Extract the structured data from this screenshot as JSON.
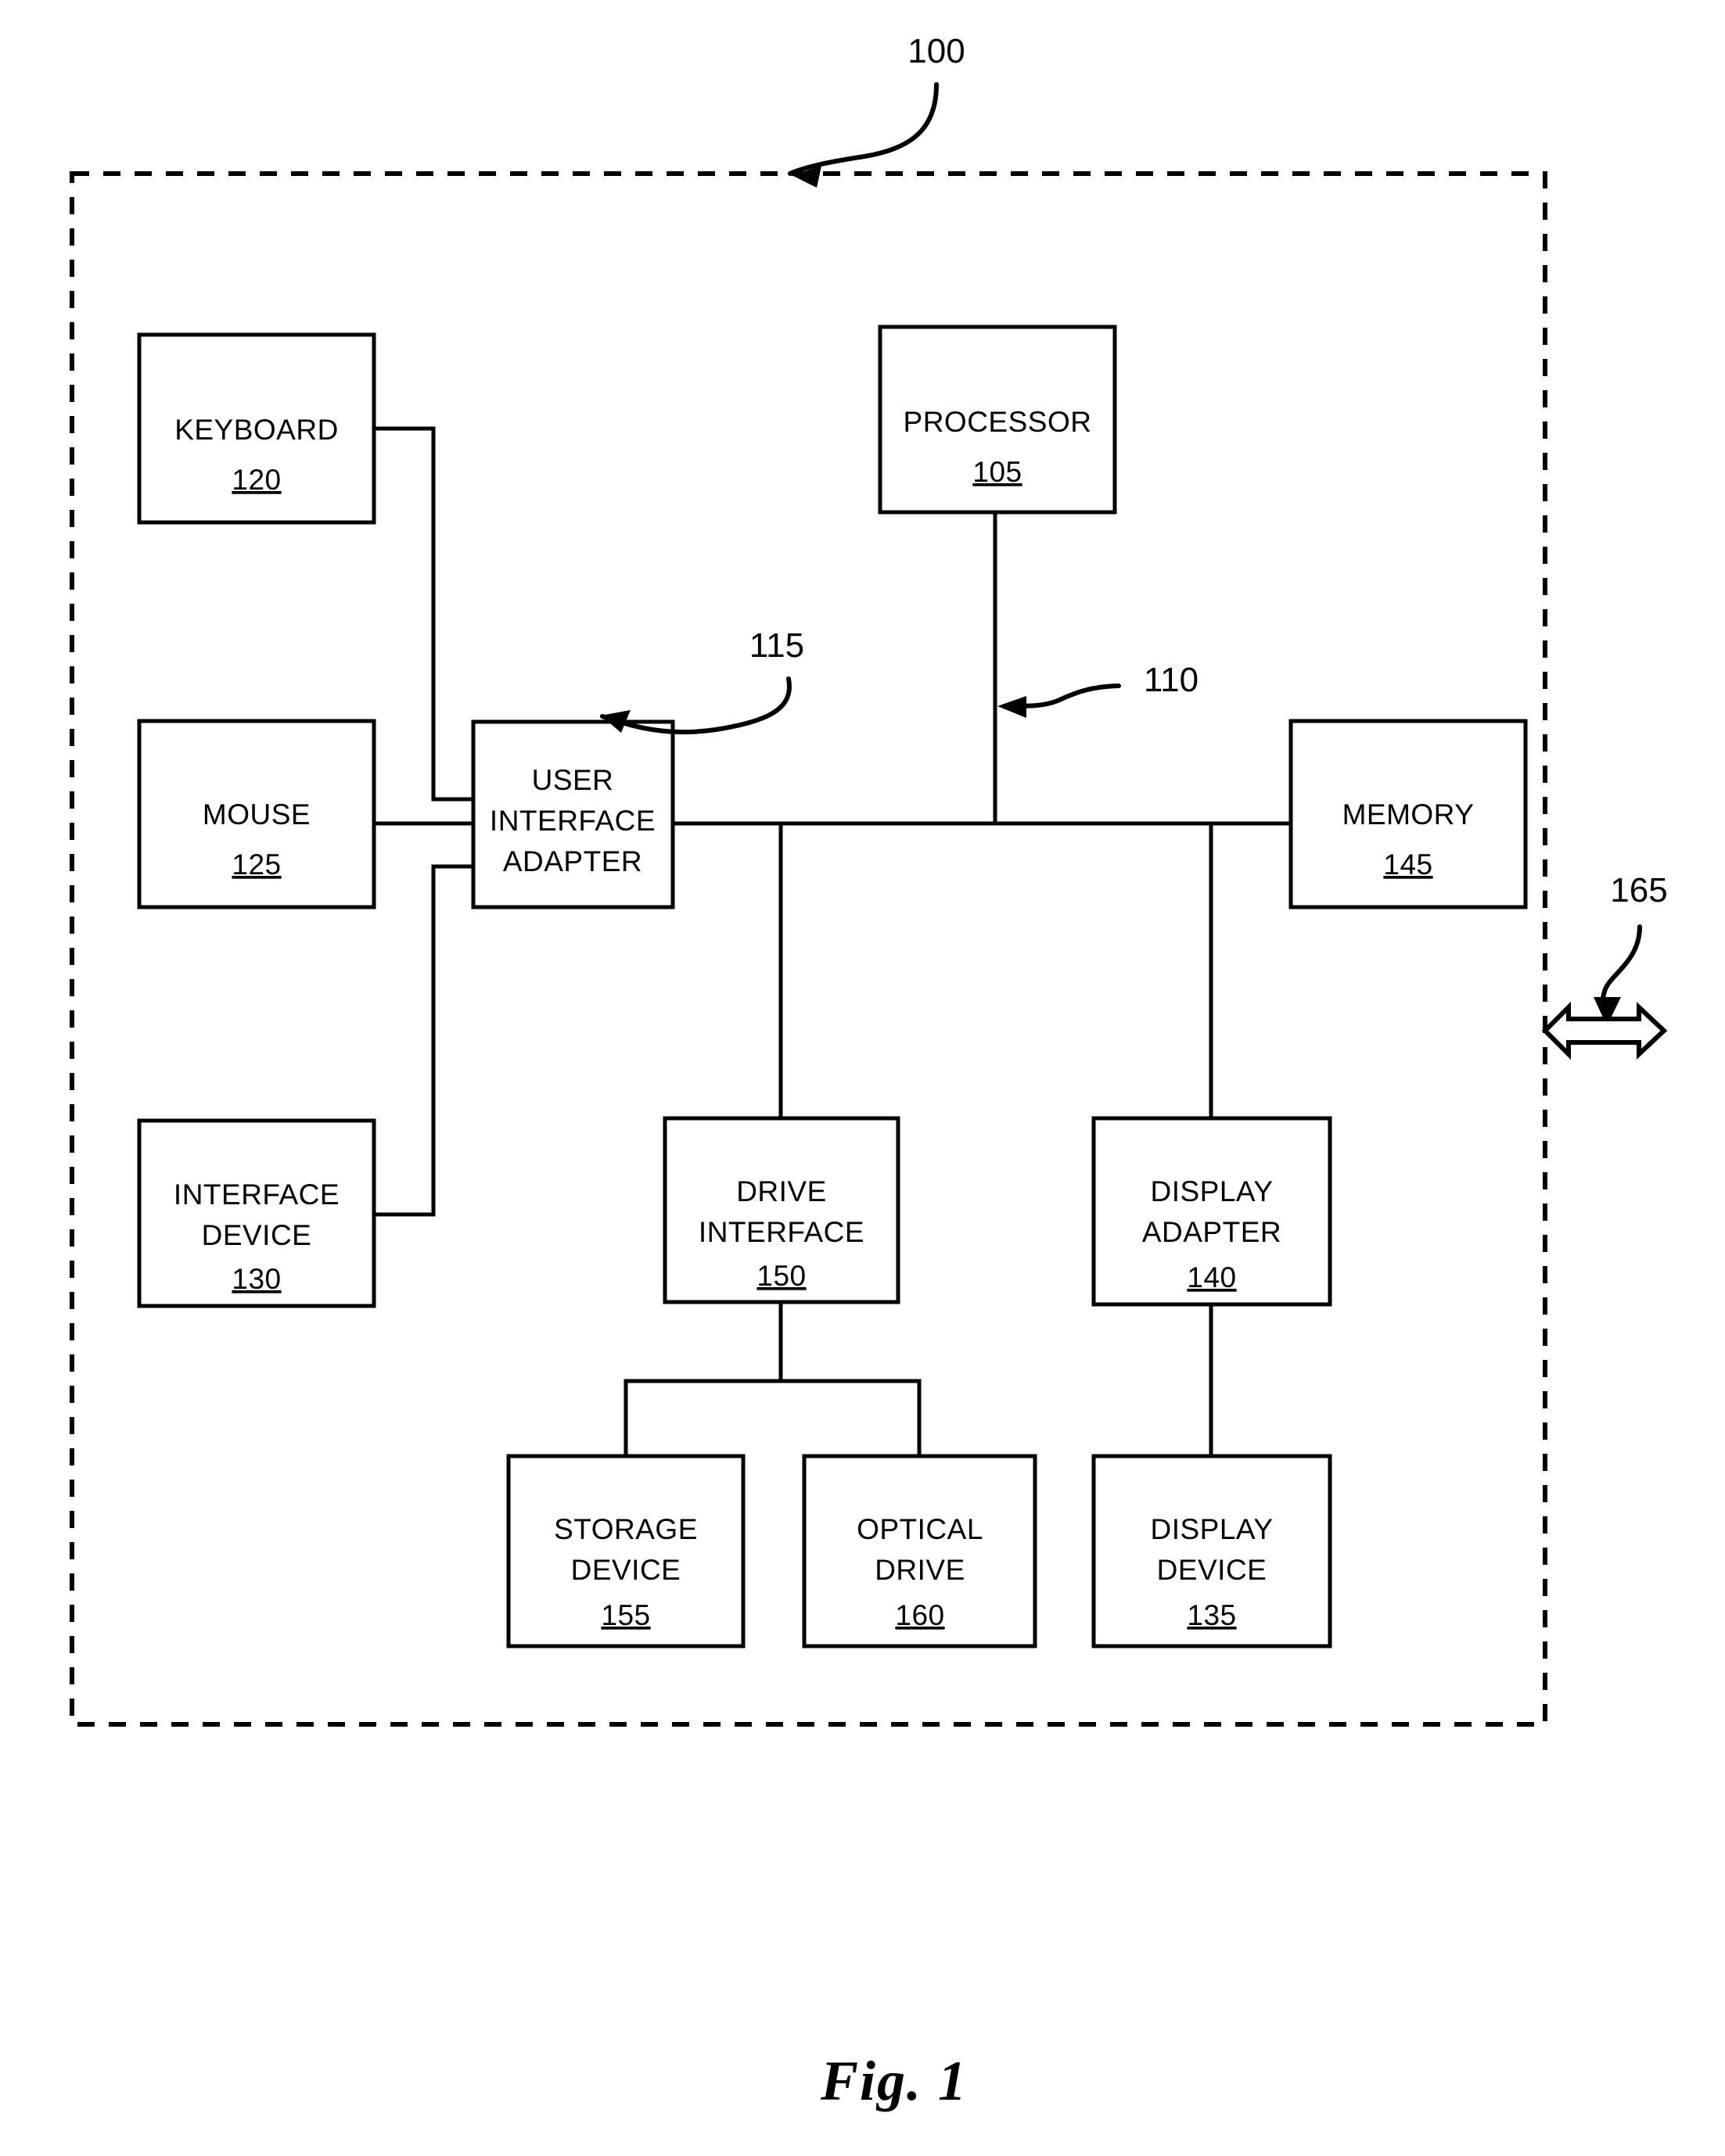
{
  "figure": {
    "caption": "Fig. 1",
    "system_callout": "100",
    "bus_callout": "110",
    "ui_adapter_callout": "115",
    "external_link_callout": "165"
  },
  "blocks": {
    "keyboard": {
      "line1": "KEYBOARD",
      "line2": "",
      "ref": "120"
    },
    "mouse": {
      "line1": "MOUSE",
      "line2": "",
      "ref": "125"
    },
    "interface_device": {
      "line1": "INTERFACE",
      "line2": "DEVICE",
      "ref": "130"
    },
    "user_interface_adapter": {
      "line1": "USER",
      "line2": "INTERFACE",
      "line3": "ADAPTER",
      "ref": ""
    },
    "processor": {
      "line1": "PROCESSOR",
      "line2": "",
      "ref": "105"
    },
    "memory": {
      "line1": "MEMORY",
      "line2": "",
      "ref": "145"
    },
    "drive_interface": {
      "line1": "DRIVE",
      "line2": "INTERFACE",
      "ref": "150"
    },
    "display_adapter": {
      "line1": "DISPLAY",
      "line2": "ADAPTER",
      "ref": "140"
    },
    "storage_device": {
      "line1": "STORAGE",
      "line2": "DEVICE",
      "ref": "155"
    },
    "optical_drive": {
      "line1": "OPTICAL",
      "line2": "DRIVE",
      "ref": "160"
    },
    "display_device": {
      "line1": "DISPLAY",
      "line2": "DEVICE",
      "ref": "135"
    }
  },
  "colors": {
    "ink": "#000000",
    "paper": "#ffffff"
  }
}
